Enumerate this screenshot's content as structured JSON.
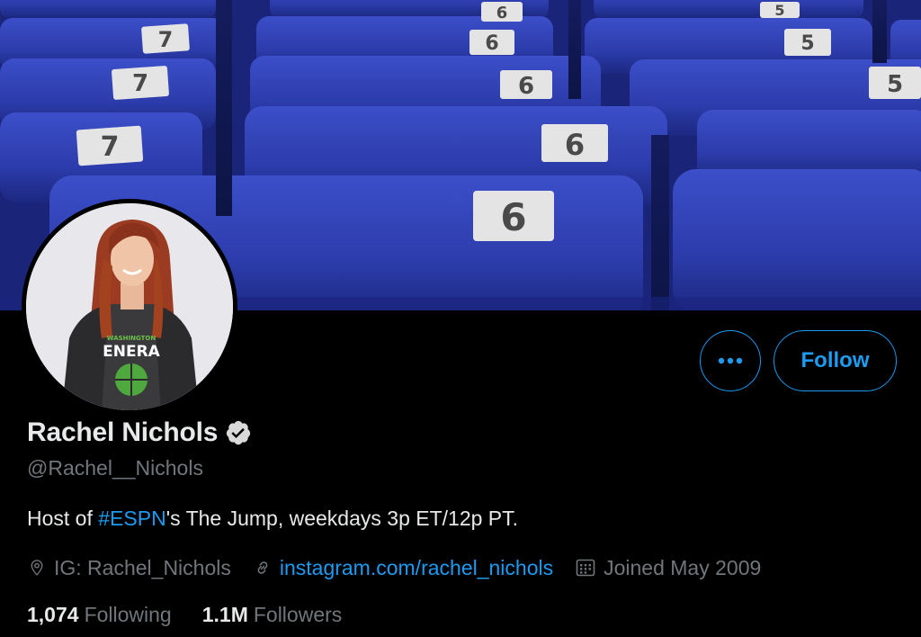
{
  "profile": {
    "name": "Rachel Nichols",
    "handle": "@Rachel__Nichols",
    "bio": {
      "prefix": "Host of ",
      "hashtag": "#ESPN",
      "suffix": "'s The Jump, weekdays 3p ET/12p PT."
    },
    "location": "IG: Rachel_Nichols",
    "website": "instagram.com/rachel_nichols",
    "joined": "Joined May 2009",
    "following_count": "1,074",
    "following_label": "Following",
    "followers_count": "1.1M",
    "followers_label": "Followers",
    "verified": true
  },
  "banner": {
    "seat_numbers": [
      "7",
      "7",
      "7",
      "6",
      "6",
      "6",
      "6",
      "6",
      "5",
      "5",
      "5"
    ]
  },
  "avatar": {
    "shirt_text": "ENERA",
    "shirt_small_text": "WASHINGTON"
  },
  "actions": {
    "follow_label": "Follow",
    "more_icon": "ellipsis-icon"
  },
  "colors": {
    "accent": "#1d9bf0",
    "background": "#000000",
    "secondary_text": "#71767b",
    "primary_text": "#e7e9ea"
  }
}
